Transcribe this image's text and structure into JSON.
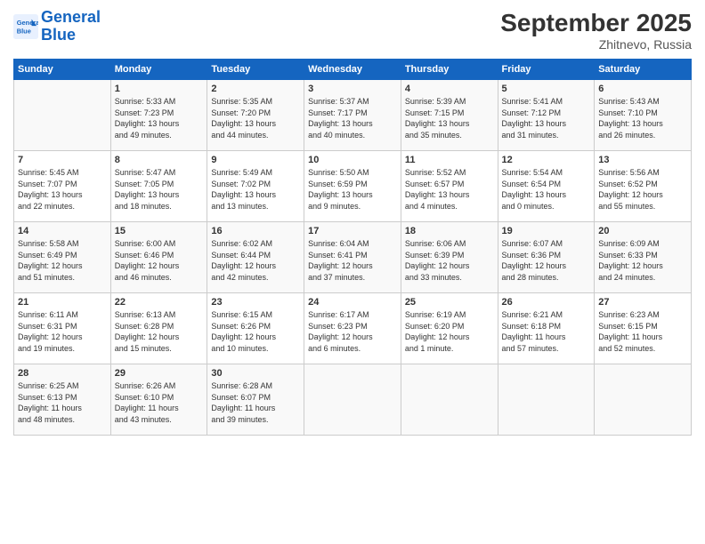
{
  "header": {
    "logo_line1": "General",
    "logo_line2": "Blue",
    "title": "September 2025",
    "location": "Zhitnevo, Russia"
  },
  "days_of_week": [
    "Sunday",
    "Monday",
    "Tuesday",
    "Wednesday",
    "Thursday",
    "Friday",
    "Saturday"
  ],
  "weeks": [
    [
      {
        "day": "",
        "text": ""
      },
      {
        "day": "1",
        "text": "Sunrise: 5:33 AM\nSunset: 7:23 PM\nDaylight: 13 hours\nand 49 minutes."
      },
      {
        "day": "2",
        "text": "Sunrise: 5:35 AM\nSunset: 7:20 PM\nDaylight: 13 hours\nand 44 minutes."
      },
      {
        "day": "3",
        "text": "Sunrise: 5:37 AM\nSunset: 7:17 PM\nDaylight: 13 hours\nand 40 minutes."
      },
      {
        "day": "4",
        "text": "Sunrise: 5:39 AM\nSunset: 7:15 PM\nDaylight: 13 hours\nand 35 minutes."
      },
      {
        "day": "5",
        "text": "Sunrise: 5:41 AM\nSunset: 7:12 PM\nDaylight: 13 hours\nand 31 minutes."
      },
      {
        "day": "6",
        "text": "Sunrise: 5:43 AM\nSunset: 7:10 PM\nDaylight: 13 hours\nand 26 minutes."
      }
    ],
    [
      {
        "day": "7",
        "text": "Sunrise: 5:45 AM\nSunset: 7:07 PM\nDaylight: 13 hours\nand 22 minutes."
      },
      {
        "day": "8",
        "text": "Sunrise: 5:47 AM\nSunset: 7:05 PM\nDaylight: 13 hours\nand 18 minutes."
      },
      {
        "day": "9",
        "text": "Sunrise: 5:49 AM\nSunset: 7:02 PM\nDaylight: 13 hours\nand 13 minutes."
      },
      {
        "day": "10",
        "text": "Sunrise: 5:50 AM\nSunset: 6:59 PM\nDaylight: 13 hours\nand 9 minutes."
      },
      {
        "day": "11",
        "text": "Sunrise: 5:52 AM\nSunset: 6:57 PM\nDaylight: 13 hours\nand 4 minutes."
      },
      {
        "day": "12",
        "text": "Sunrise: 5:54 AM\nSunset: 6:54 PM\nDaylight: 13 hours\nand 0 minutes."
      },
      {
        "day": "13",
        "text": "Sunrise: 5:56 AM\nSunset: 6:52 PM\nDaylight: 12 hours\nand 55 minutes."
      }
    ],
    [
      {
        "day": "14",
        "text": "Sunrise: 5:58 AM\nSunset: 6:49 PM\nDaylight: 12 hours\nand 51 minutes."
      },
      {
        "day": "15",
        "text": "Sunrise: 6:00 AM\nSunset: 6:46 PM\nDaylight: 12 hours\nand 46 minutes."
      },
      {
        "day": "16",
        "text": "Sunrise: 6:02 AM\nSunset: 6:44 PM\nDaylight: 12 hours\nand 42 minutes."
      },
      {
        "day": "17",
        "text": "Sunrise: 6:04 AM\nSunset: 6:41 PM\nDaylight: 12 hours\nand 37 minutes."
      },
      {
        "day": "18",
        "text": "Sunrise: 6:06 AM\nSunset: 6:39 PM\nDaylight: 12 hours\nand 33 minutes."
      },
      {
        "day": "19",
        "text": "Sunrise: 6:07 AM\nSunset: 6:36 PM\nDaylight: 12 hours\nand 28 minutes."
      },
      {
        "day": "20",
        "text": "Sunrise: 6:09 AM\nSunset: 6:33 PM\nDaylight: 12 hours\nand 24 minutes."
      }
    ],
    [
      {
        "day": "21",
        "text": "Sunrise: 6:11 AM\nSunset: 6:31 PM\nDaylight: 12 hours\nand 19 minutes."
      },
      {
        "day": "22",
        "text": "Sunrise: 6:13 AM\nSunset: 6:28 PM\nDaylight: 12 hours\nand 15 minutes."
      },
      {
        "day": "23",
        "text": "Sunrise: 6:15 AM\nSunset: 6:26 PM\nDaylight: 12 hours\nand 10 minutes."
      },
      {
        "day": "24",
        "text": "Sunrise: 6:17 AM\nSunset: 6:23 PM\nDaylight: 12 hours\nand 6 minutes."
      },
      {
        "day": "25",
        "text": "Sunrise: 6:19 AM\nSunset: 6:20 PM\nDaylight: 12 hours\nand 1 minute."
      },
      {
        "day": "26",
        "text": "Sunrise: 6:21 AM\nSunset: 6:18 PM\nDaylight: 11 hours\nand 57 minutes."
      },
      {
        "day": "27",
        "text": "Sunrise: 6:23 AM\nSunset: 6:15 PM\nDaylight: 11 hours\nand 52 minutes."
      }
    ],
    [
      {
        "day": "28",
        "text": "Sunrise: 6:25 AM\nSunset: 6:13 PM\nDaylight: 11 hours\nand 48 minutes."
      },
      {
        "day": "29",
        "text": "Sunrise: 6:26 AM\nSunset: 6:10 PM\nDaylight: 11 hours\nand 43 minutes."
      },
      {
        "day": "30",
        "text": "Sunrise: 6:28 AM\nSunset: 6:07 PM\nDaylight: 11 hours\nand 39 minutes."
      },
      {
        "day": "",
        "text": ""
      },
      {
        "day": "",
        "text": ""
      },
      {
        "day": "",
        "text": ""
      },
      {
        "day": "",
        "text": ""
      }
    ]
  ]
}
